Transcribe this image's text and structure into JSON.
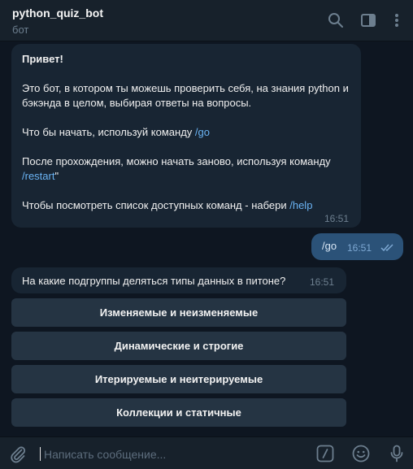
{
  "header": {
    "title": "python_quiz_bot",
    "subtitle": "бот",
    "icons": [
      "search-icon",
      "sidebar-toggle-icon",
      "more-vertical-icon"
    ]
  },
  "messages": {
    "intro": {
      "greeting": "Привет!",
      "line1": "Это бот, в котором ты можешь проверить себя, на знания python и бэкэнда в целом, выбирая ответы на вопросы.",
      "line2_prefix": "Что бы начать, используй команду ",
      "line2_cmd": "/go",
      "line3_prefix": "После прохождения, можно начать заново, используя команду ",
      "line3_cmd": "/restart",
      "line3_suffix": "\"",
      "line4_prefix": "Чтобы посмотреть список доступных команд - набери ",
      "line4_cmd": "/help",
      "time": "16:51"
    },
    "outgoing": {
      "text": "/go",
      "time": "16:51"
    },
    "question": {
      "text": "На какие подгруппы деляться типы данных в питоне?",
      "time": "16:51"
    }
  },
  "keyboard": {
    "options": [
      "Изменяемые и неизменяемые",
      "Динамические и строгие",
      "Итерируемые и неитерируемые",
      "Коллекции и статичные"
    ]
  },
  "composer": {
    "placeholder": "Написать сообщение...",
    "icons": [
      "attach-icon",
      "bot-commands-icon",
      "emoji-icon",
      "microphone-icon"
    ]
  },
  "colors": {
    "background": "#0e1621",
    "panel": "#17212b",
    "incoming_bubble": "#182533",
    "outgoing_bubble": "#2b5278",
    "keyboard_button": "#253443",
    "link": "#6ab3f3",
    "muted": "#6d7f8f"
  }
}
